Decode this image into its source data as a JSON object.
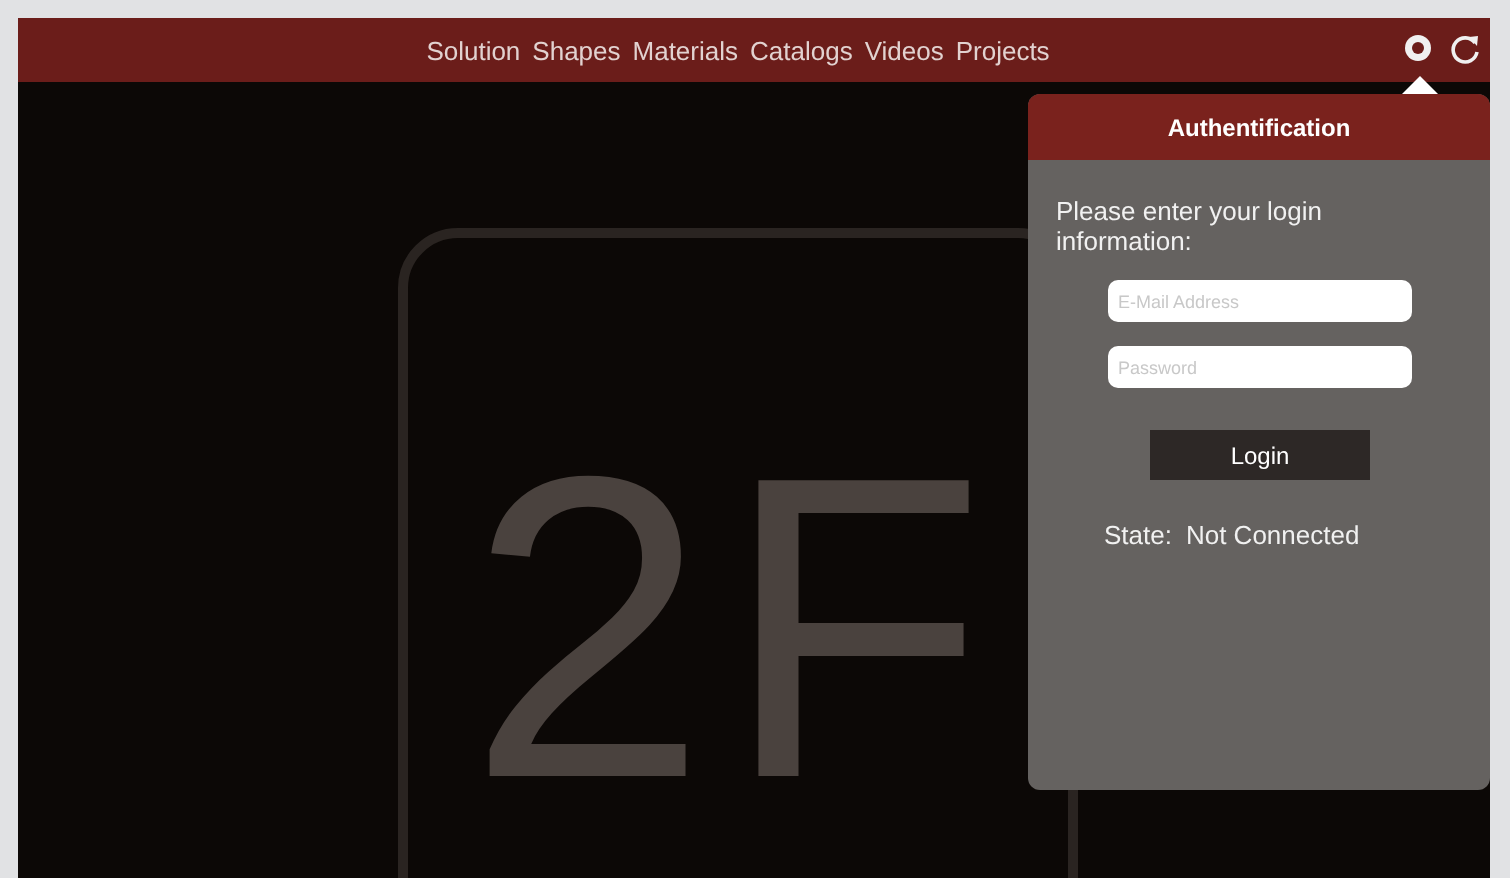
{
  "nav": {
    "items": [
      {
        "label": "Solution"
      },
      {
        "label": "Shapes"
      },
      {
        "label": "Materials"
      },
      {
        "label": "Catalogs"
      },
      {
        "label": "Videos"
      },
      {
        "label": "Projects"
      }
    ]
  },
  "background_logo": {
    "text": "2F"
  },
  "auth_popover": {
    "title": "Authentification",
    "prompt": "Please enter your login information:",
    "email": {
      "placeholder": "E-Mail Address"
    },
    "password": {
      "placeholder": "Password"
    },
    "login_button": "Login",
    "state_label": "State:",
    "state_value": "Not Connected"
  }
}
